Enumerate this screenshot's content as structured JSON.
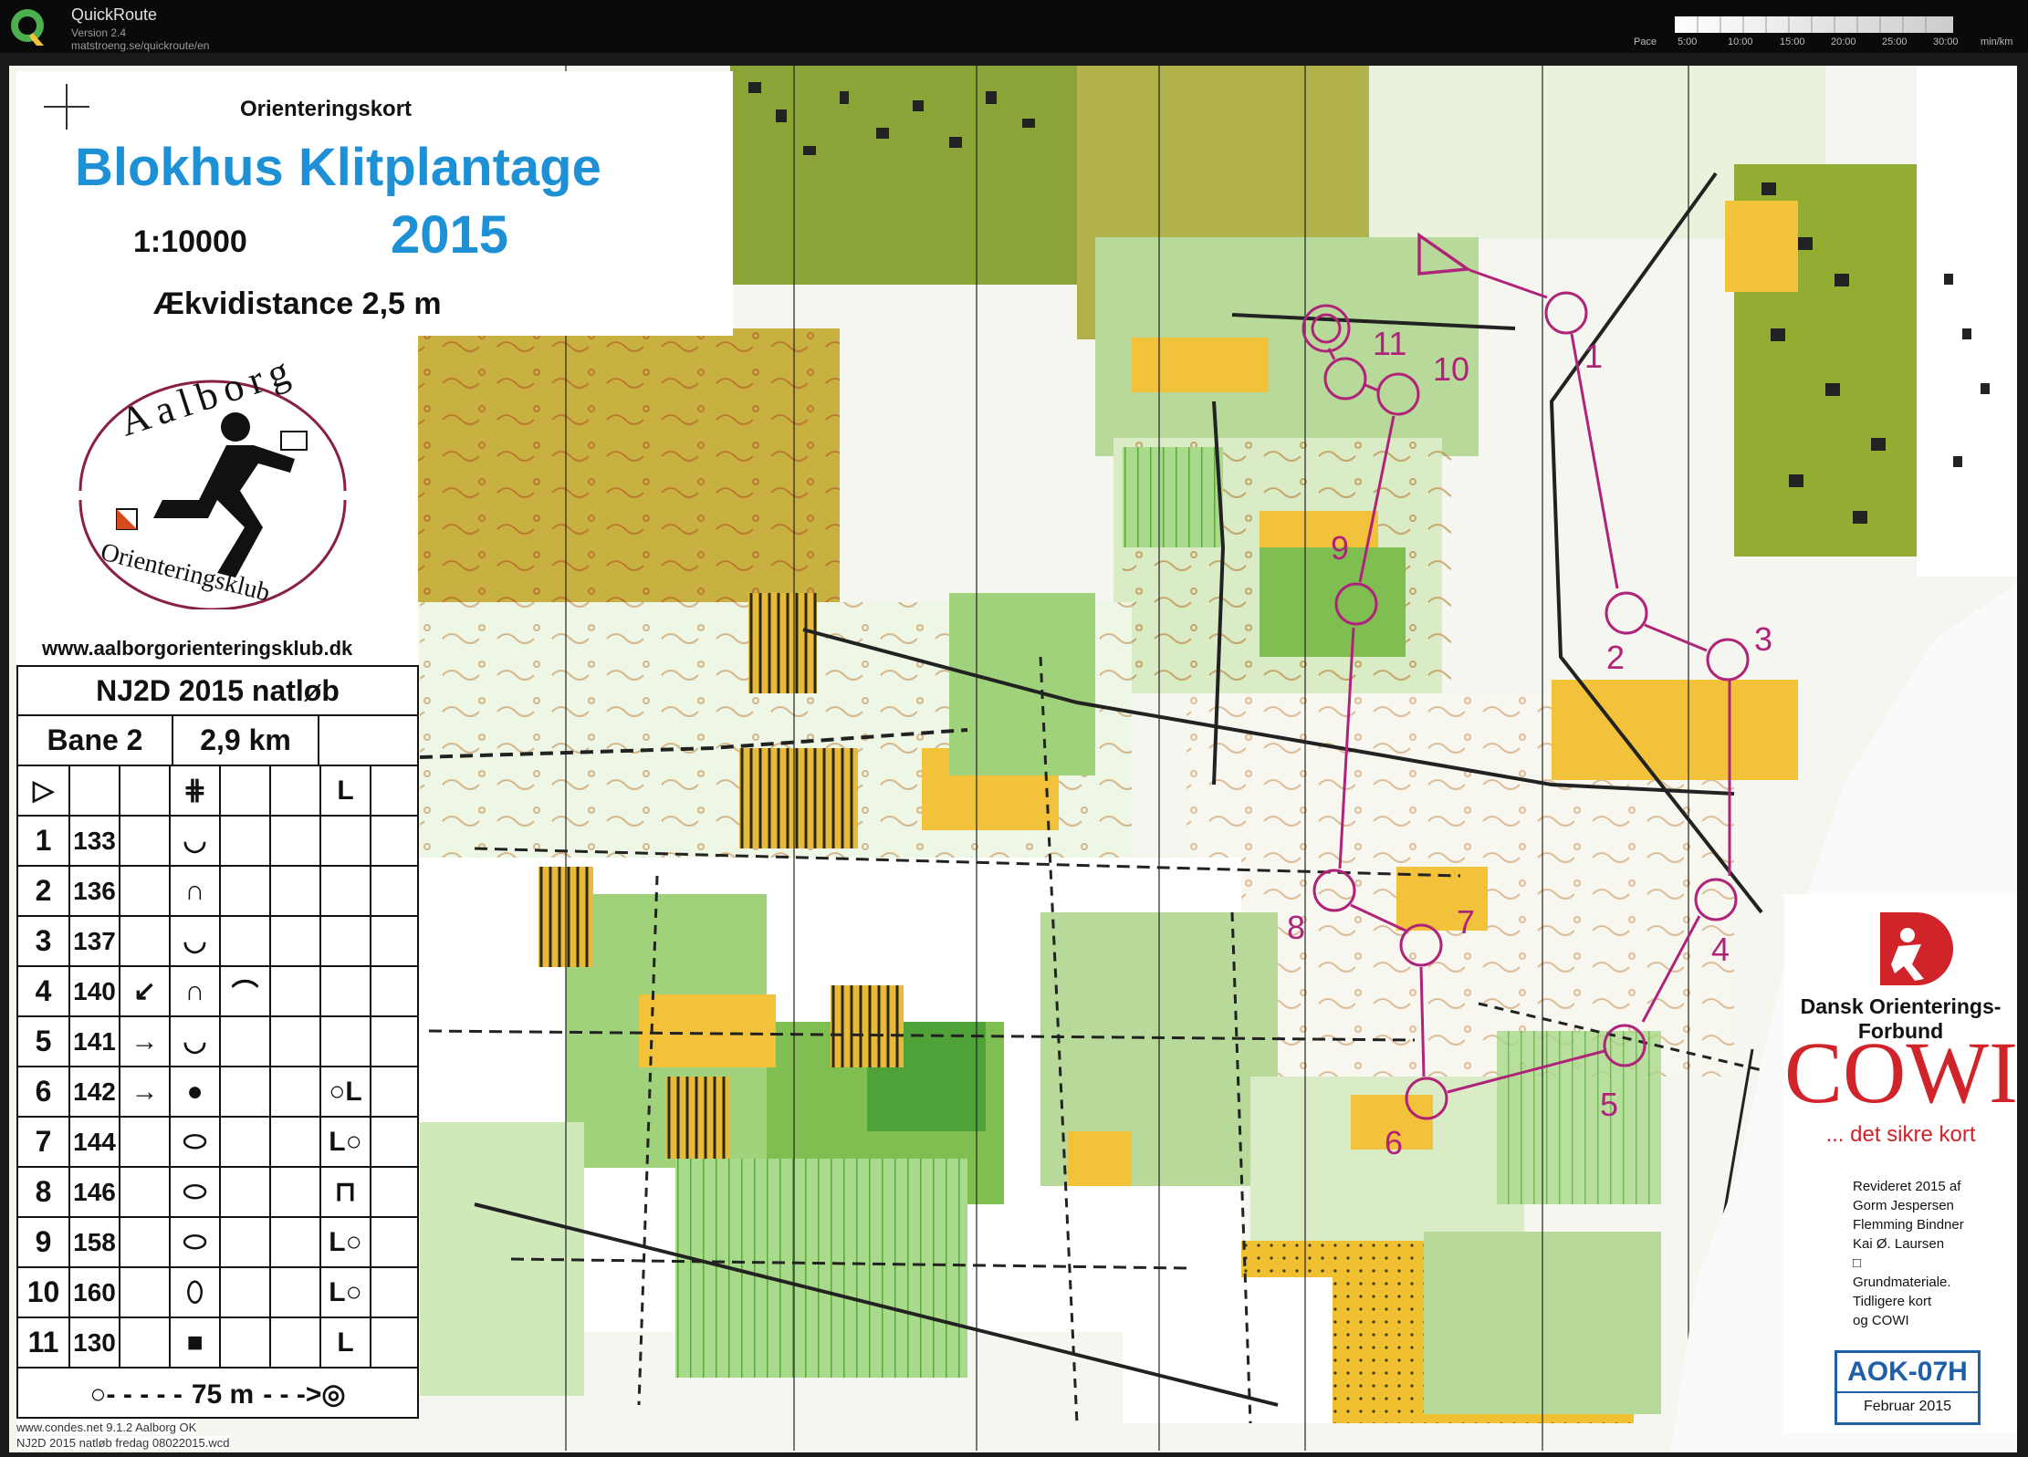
{
  "app": {
    "title": "QuickRoute",
    "version": "Version 2.4",
    "url": "matstroeng.se/quickroute/en",
    "pace_label": "Pace",
    "pace_ticks": [
      "5:00",
      "10:00",
      "15:00",
      "20:00",
      "25:00",
      "30:00"
    ],
    "pace_unit": "min/km"
  },
  "map_header": {
    "type_label": "Orienteringskort",
    "name": "Blokhus Klitplantage",
    "year": "2015",
    "scale": "1:10000",
    "contour": "Ækvidistance 2,5 m"
  },
  "club": {
    "logo_top_text": "Aalborg",
    "logo_bottom_text": "Orienteringsklub",
    "website": "www.aalborgorienteringsklub.dk"
  },
  "course": {
    "event": "NJ2D 2015 natløb",
    "course_name": "Bane 2",
    "length": "2,9 km",
    "start_symbols": [
      "▷",
      "",
      "",
      "⋕",
      "",
      "",
      "L"
    ],
    "controls": [
      {
        "num": "1",
        "code": "133",
        "dir": "",
        "feature": "◡",
        "extra": "",
        "pos": ""
      },
      {
        "num": "2",
        "code": "136",
        "dir": "",
        "feature": "∩",
        "extra": "",
        "pos": ""
      },
      {
        "num": "3",
        "code": "137",
        "dir": "",
        "feature": "◡",
        "extra": "",
        "pos": ""
      },
      {
        "num": "4",
        "code": "140",
        "dir": "↙",
        "feature": "∩",
        "extra": "⌒",
        "pos": ""
      },
      {
        "num": "5",
        "code": "141",
        "dir": "→",
        "feature": "◡",
        "extra": "",
        "pos": ""
      },
      {
        "num": "6",
        "code": "142",
        "dir": "→",
        "feature": "●",
        "extra": "",
        "pos": "○L"
      },
      {
        "num": "7",
        "code": "144",
        "dir": "",
        "feature": "⬭",
        "extra": "",
        "pos": "L○"
      },
      {
        "num": "8",
        "code": "146",
        "dir": "",
        "feature": "⬭",
        "extra": "",
        "pos": "⊓"
      },
      {
        "num": "9",
        "code": "158",
        "dir": "",
        "feature": "⬭",
        "extra": "",
        "pos": "L○"
      },
      {
        "num": "10",
        "code": "160",
        "dir": "",
        "feature": "⬯",
        "extra": "",
        "pos": "L○"
      },
      {
        "num": "11",
        "code": "130",
        "dir": "",
        "feature": "■",
        "extra": "",
        "pos": "L"
      }
    ],
    "finish_text": "75 m",
    "footer_line1": "www.condes.net 9.1.2 Aalborg OK",
    "footer_line2": "NJ2D 2015 natløb fredag 08022015.wcd"
  },
  "course_labels": [
    "1",
    "2",
    "3",
    "4",
    "5",
    "6",
    "7",
    "8",
    "9",
    "10",
    "11"
  ],
  "sponsors": {
    "federation": "Dansk Orienterings-Forbund",
    "cowi": "COWI",
    "cowi_tagline": "... det sikre kort",
    "revision_lines": [
      "Revideret 2015 af",
      "Gorm Jespersen",
      "Flemming Bindner",
      "Kai Ø. Laursen",
      "□",
      "Grundmateriale.",
      "Tidligere kort",
      "og COWI"
    ],
    "map_code": "AOK-07H",
    "map_date": "Februar 2015"
  },
  "colors": {
    "overprint": "#b0237a",
    "title_blue": "#1e90d6",
    "forest_green": "#8cc65a",
    "open_yellow": "#f2c23a",
    "cowi_red": "#d0232a"
  }
}
